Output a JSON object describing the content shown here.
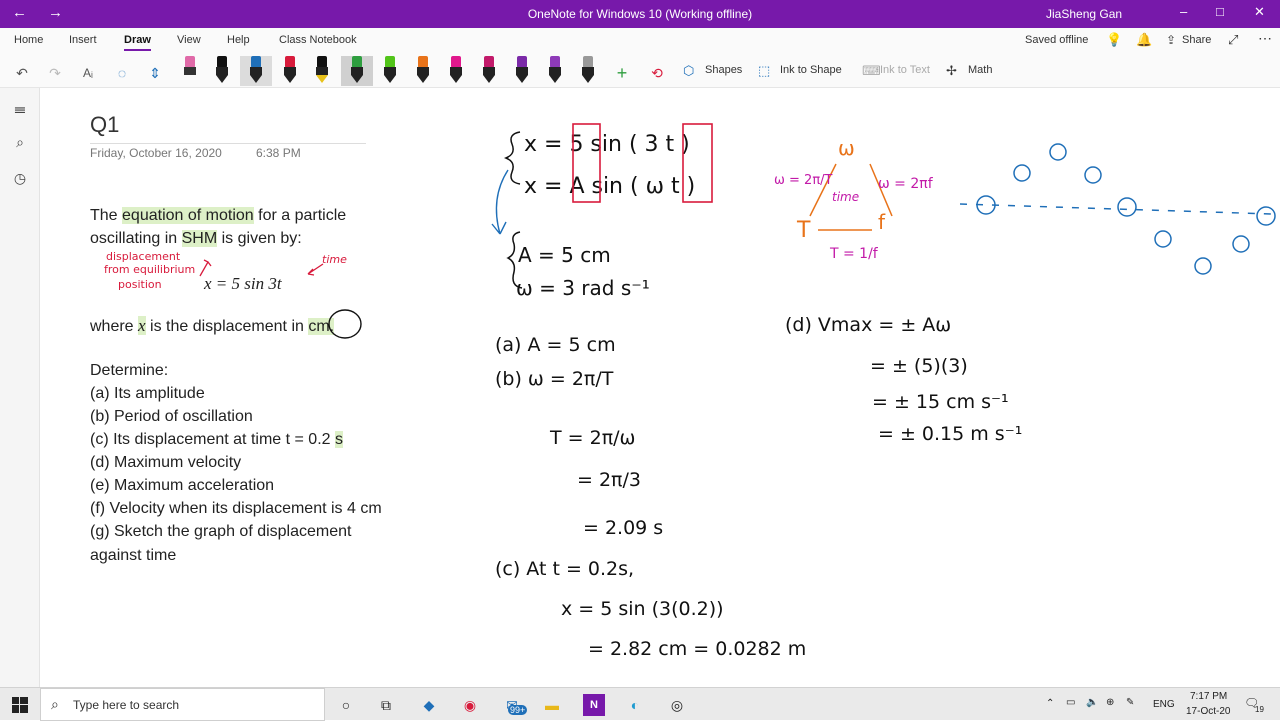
{
  "window": {
    "title": "OneNote for Windows 10 (Working offline)",
    "user": "JiaSheng Gan"
  },
  "ribbon": {
    "tabs": [
      "Home",
      "Insert",
      "Draw",
      "View",
      "Help",
      "Class Notebook"
    ],
    "active_tab": "Draw",
    "status": "Saved offline",
    "share": "Share",
    "shapes": "Shapes",
    "ink_to_shape": "Ink to Shape",
    "ink_to_text": "Ink to Text",
    "math": "Math"
  },
  "page": {
    "title": "Q1",
    "date": "Friday, October 16, 2020",
    "time": "6:38 PM"
  },
  "question": {
    "p1_pre": "The",
    "p1_hl1": "equation of motion",
    "p1_mid": "for a particle",
    "p2_pre": "oscillating in",
    "p2_hl2": "SHM",
    "p2_post": "is given by:",
    "equation": "x = 5 sin 3t",
    "where_pre": "where",
    "where_var": "x",
    "where_mid": "is the displacement in",
    "where_unit": "cm.",
    "determine": "Determine:",
    "items": [
      "(a) Its amplitude",
      "(b) Period of oscillation",
      "(c) Its displacement at time t = 0.2",
      "(d) Maximum velocity",
      "(e) Maximum acceleration",
      "(f) Velocity when its displacement is 4 cm",
      "(g) Sketch the graph of displacement",
      "against time"
    ],
    "item_c_unit": "s"
  },
  "ink": {
    "label_displacement": [
      "displacement",
      "from equilibrium",
      "position"
    ],
    "label_time": "time",
    "eq_top": "x = 5 sin ( 3 t )",
    "eq_bottom": "x = A sin ( ω t )",
    "a_val": "A = 5 cm",
    "w_val": "ω = 3 rad s⁻¹",
    "sol_a": "(a) A = 5 cm",
    "sol_b1": "(b) ω = 2π/T",
    "sol_b2": "T = 2π/ω",
    "sol_b3": "= 2π/3",
    "sol_b4": "= 2.09 s",
    "sol_c1": "(c) At t = 0.2s,",
    "sol_c2": "x = 5 sin (3(0.2))",
    "sol_c3": "= 2.82 cm = 0.0282 m",
    "sol_d1": "(d) Vmax = ± Aω",
    "sol_d2": "= ± (5)(3)",
    "sol_d3": "= ± 15 cm s⁻¹",
    "sol_d4": "= ± 0.15 m s⁻¹",
    "tri_top": "ω",
    "tri_left": "T",
    "tri_right": "f",
    "tri_center": "time",
    "tri_w_T": "ω = 2π/T",
    "tri_w_f": "ω = 2πf",
    "tri_T_f": "T = 1/f"
  },
  "taskbar": {
    "search_placeholder": "Type here to search",
    "mail_badge": "99+",
    "lang": "ENG",
    "clock_time": "7:17 PM",
    "clock_date": "17-Oct-20",
    "notif_count": "19"
  },
  "colors": {
    "accent": "#7719aa",
    "ink_black": "#111111",
    "ink_red": "#d81b3c",
    "ink_blue": "#1f6fb8",
    "ink_orange": "#e8731a",
    "ink_magenta": "#c21aa8",
    "highlight": "#ddf0c7"
  }
}
